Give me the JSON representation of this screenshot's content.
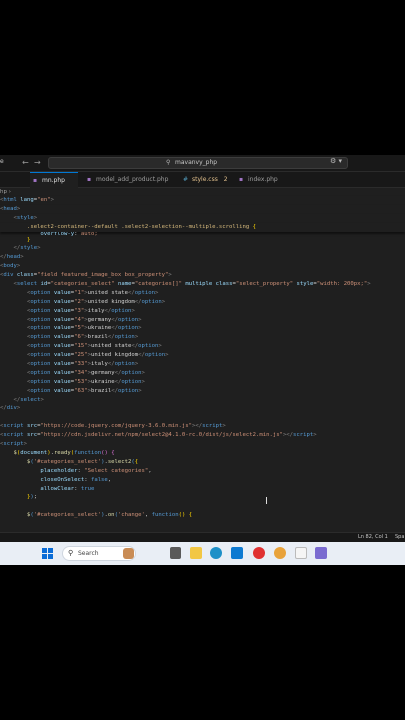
{
  "titlebar": {
    "left_label": "e",
    "back_icon": "arrow-left-icon",
    "forward_icon": "arrow-right-icon",
    "search_text": "mavanvy_php",
    "search_icon": "search-icon"
  },
  "tabs": [
    {
      "label": "mn.php",
      "active": true,
      "close": "×"
    },
    {
      "label": "model_add_product.php",
      "active": false
    },
    {
      "label": "style.css",
      "active": false,
      "badge": "2"
    },
    {
      "label": "index.php",
      "active": false
    }
  ],
  "breadcrumb": "hp ›",
  "status": {
    "position": "Ln 82, Col 1",
    "spaces": "Spa"
  },
  "taskbar": {
    "search_placeholder": "Search"
  },
  "colors": {
    "editor_bg": "#1f1f1f",
    "accent": "#0078d4",
    "taskbar_bg": "#e9eef5"
  }
}
